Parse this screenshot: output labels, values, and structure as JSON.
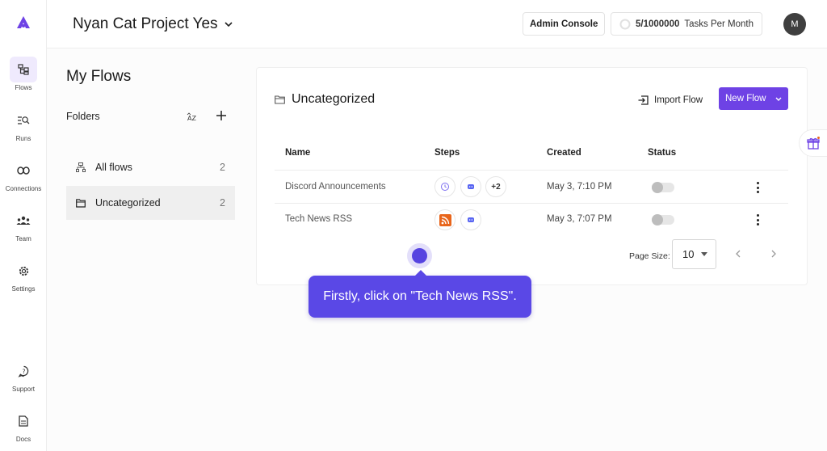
{
  "sidebar": {
    "items": [
      {
        "label": "Flows",
        "icon": "flows-icon"
      },
      {
        "label": "Runs",
        "icon": "runs-icon"
      },
      {
        "label": "Connections",
        "icon": "connections-icon"
      },
      {
        "label": "Team",
        "icon": "team-icon"
      },
      {
        "label": "Settings",
        "icon": "settings-icon"
      },
      {
        "label": "Support",
        "icon": "support-icon"
      },
      {
        "label": "Docs",
        "icon": "docs-icon"
      }
    ]
  },
  "header": {
    "project_title": "Nyan Cat Project Yes",
    "admin_label": "Admin Console",
    "tasks_count": "5/1000000",
    "tasks_label": "Tasks Per Month",
    "avatar_initial": "M"
  },
  "folders_panel": {
    "title": "My Flows",
    "folders_label": "Folders",
    "sort_icon_text": "AZ",
    "folders": [
      {
        "name": "All flows",
        "count": "2"
      },
      {
        "name": "Uncategorized",
        "count": "2"
      }
    ]
  },
  "flows_card": {
    "title": "Uncategorized",
    "import_label": "Import Flow",
    "new_flow_label": "New Flow",
    "columns": [
      "Name",
      "Steps",
      "Created",
      "Status"
    ],
    "rows": [
      {
        "name": "Discord Announcements",
        "steps_more": "+2",
        "created": "May 3, 7:10 PM"
      },
      {
        "name": "Tech News RSS",
        "created": "May 3, 7:07 PM"
      }
    ],
    "pager": {
      "label": "Page Size:",
      "value": "10"
    }
  },
  "tooltip": {
    "text": "Firstly, click on \"Tech News RSS\"."
  },
  "colors": {
    "accent": "#6e42e5",
    "tooltip": "#5a48e6"
  }
}
